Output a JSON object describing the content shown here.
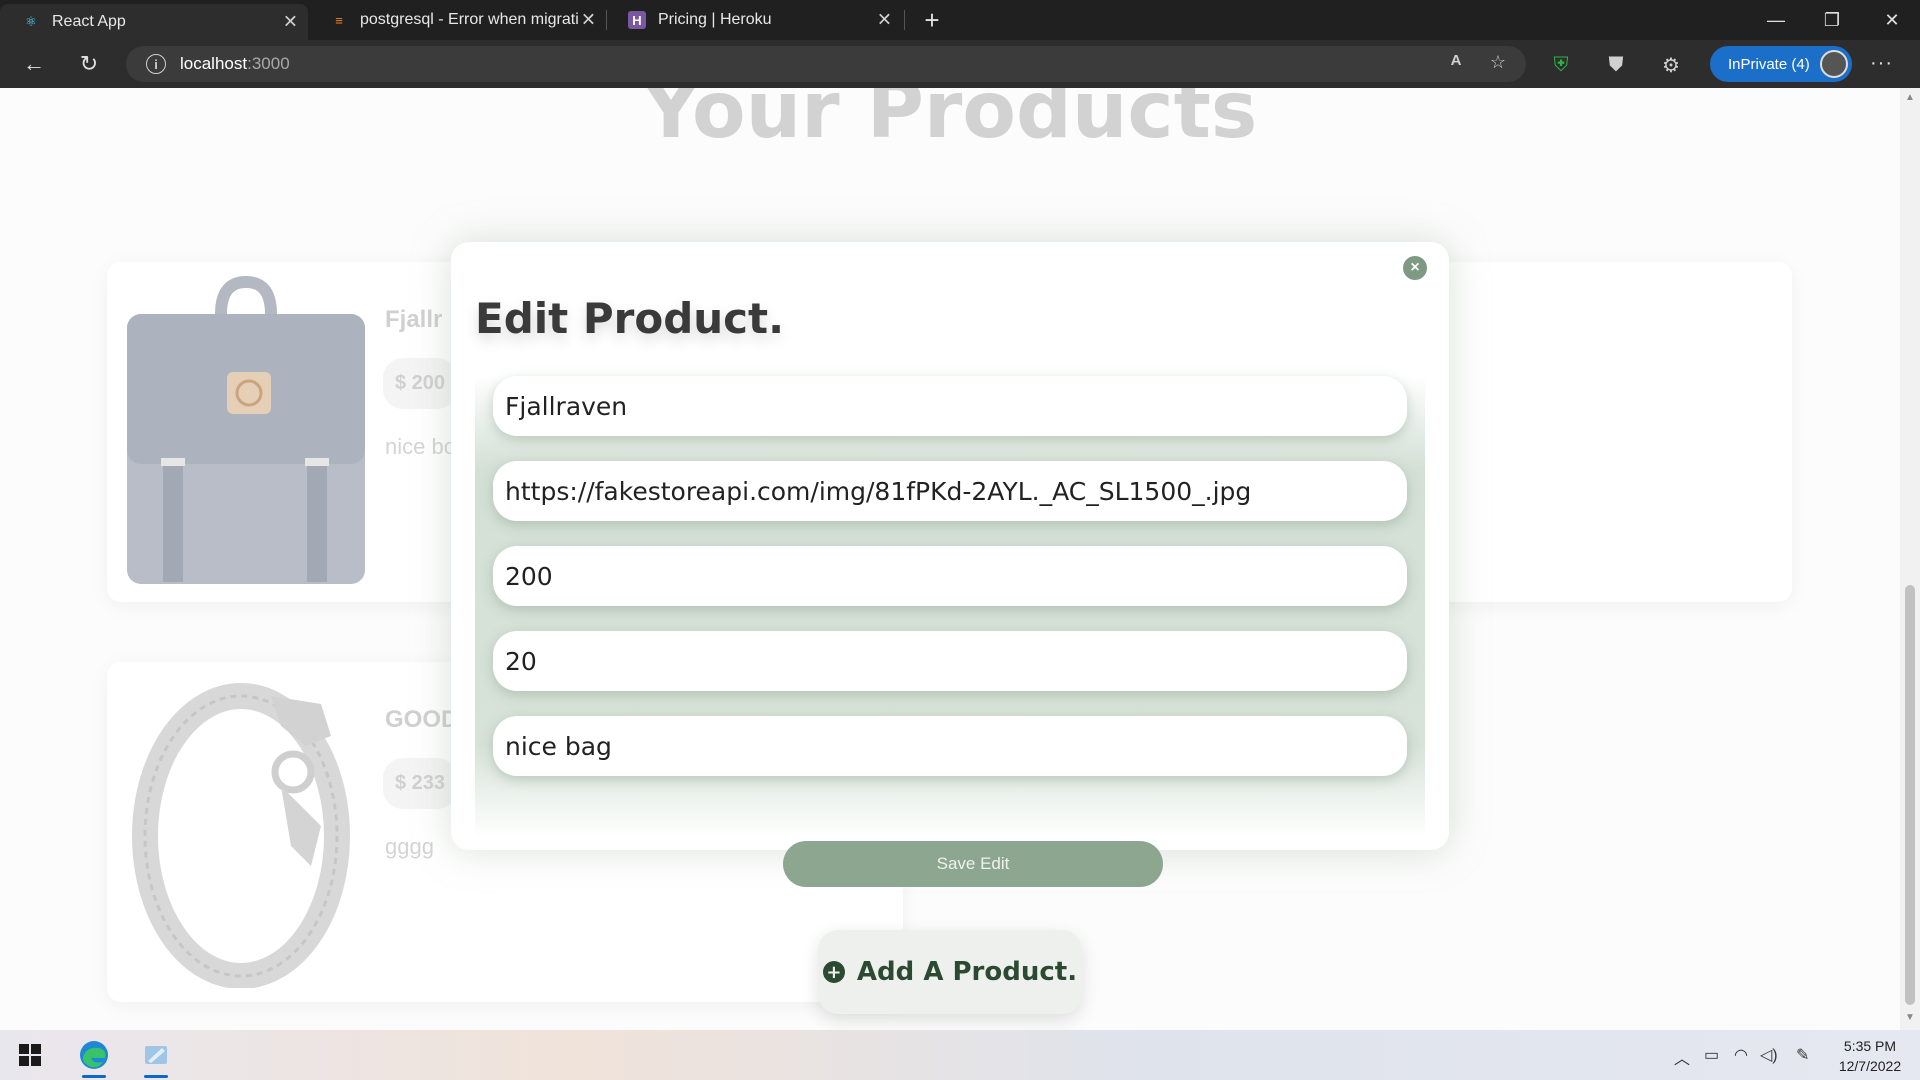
{
  "browser": {
    "tabs": [
      {
        "title": "React App",
        "icon": "react-icon"
      },
      {
        "title": "postgresql - Error when migrating",
        "icon": "stackoverflow-icon"
      },
      {
        "title": "Pricing | Heroku",
        "icon": "heroku-icon"
      }
    ],
    "address": {
      "host": "localhost",
      "port": ":3000"
    },
    "inprivate_label": "InPrivate (4)"
  },
  "page": {
    "heading": "Your Products",
    "products": [
      {
        "name": "Fjallr",
        "price": "$ 200",
        "description": "nice bc"
      },
      {
        "name": "GOOD",
        "price": "$ 233",
        "description": "gggg"
      }
    ],
    "add_button_label": "Add A Product."
  },
  "modal": {
    "title": "Edit Product.",
    "fields": {
      "name": "Fjallraven",
      "image_url": "https://fakestoreapi.com/img/81fPKd-2AYL._AC_SL1500_.jpg",
      "price": "200",
      "quantity": "20",
      "description": "nice bag"
    },
    "save_label": "Save Edit",
    "close_glyph": "×"
  },
  "taskbar": {
    "time": "5:35 PM",
    "date": "12/7/2022"
  },
  "colors": {
    "accent_green": "#8ca68f",
    "dark_green": "#2c4a31",
    "inprivate_blue": "#1c6fc9"
  }
}
